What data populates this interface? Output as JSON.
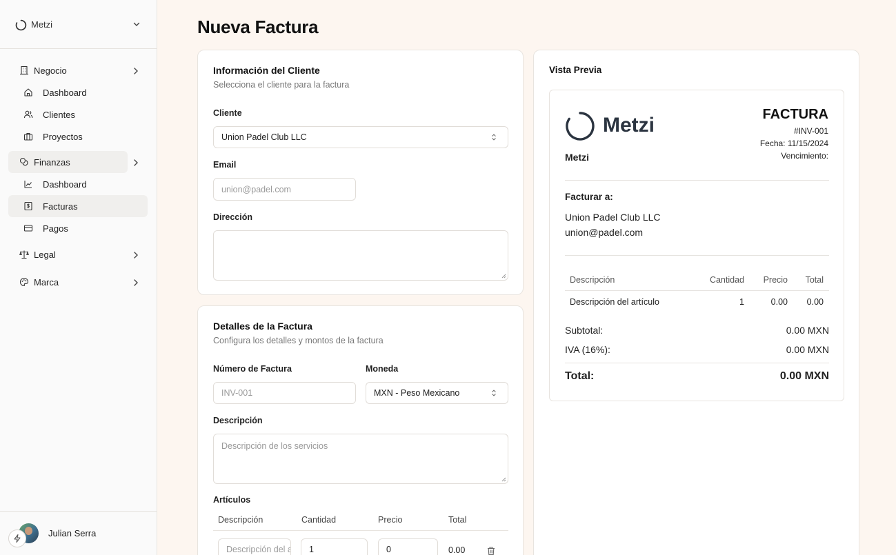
{
  "sidebar": {
    "brand": "Metzi",
    "groups": [
      {
        "label": "Negocio",
        "icon": "building-icon"
      },
      {
        "label": "Finanzas",
        "icon": "coins-icon"
      },
      {
        "label": "Legal",
        "icon": "scale-icon"
      },
      {
        "label": "Marca",
        "icon": "palette-icon"
      }
    ],
    "negocio_items": [
      {
        "label": "Dashboard",
        "icon": "home-icon"
      },
      {
        "label": "Clientes",
        "icon": "users-icon"
      },
      {
        "label": "Proyectos",
        "icon": "briefcase-icon"
      }
    ],
    "finanzas_items": [
      {
        "label": "Dashboard",
        "icon": "chart-icon"
      },
      {
        "label": "Facturas",
        "icon": "receipt-icon"
      },
      {
        "label": "Pagos",
        "icon": "credit-card-icon"
      }
    ],
    "user": {
      "name": "Julian Serra"
    }
  },
  "page": {
    "title": "Nueva Factura"
  },
  "client_card": {
    "title": "Información del Cliente",
    "subtitle": "Selecciona el cliente para la factura",
    "cliente_label": "Cliente",
    "cliente_value": "Union Padel Club LLC",
    "email_label": "Email",
    "email_placeholder": "union@padel.com",
    "direccion_label": "Dirección",
    "direccion_placeholder": ""
  },
  "details_card": {
    "title": "Detalles de la Factura",
    "subtitle": "Configura los detalles y montos de la factura",
    "numero_label": "Número de Factura",
    "numero_placeholder": "INV-001",
    "moneda_label": "Moneda",
    "moneda_value": "MXN - Peso Mexicano",
    "descripcion_label": "Descripción",
    "descripcion_placeholder": "Descripción de los servicios",
    "articulos_label": "Artículos",
    "columns": [
      "Descripción",
      "Cantidad",
      "Precio",
      "Total"
    ],
    "row": {
      "descripcion_placeholder": "Descripción del artículo",
      "cantidad": "1",
      "precio": "0",
      "total": "0.00"
    }
  },
  "preview": {
    "title": "Vista Previa",
    "logo_text": "Metzi",
    "company": "Metzi",
    "doc_title": "FACTURA",
    "number": "#INV-001",
    "fecha": "Fecha: 11/15/2024",
    "vencimiento": "Vencimiento:",
    "bill_to_label": "Facturar a:",
    "bill_to_name": "Union Padel Club LLC",
    "bill_to_email": "union@padel.com",
    "columns": [
      "Descripción",
      "Cantidad",
      "Precio",
      "Total"
    ],
    "row": {
      "descripcion": "Descripción del artículo",
      "cantidad": "1",
      "precio": "0.00",
      "total": "0.00"
    },
    "subtotal_label": "Subtotal:",
    "subtotal_value": "0.00 MXN",
    "iva_label": "IVA (16%):",
    "iva_value": "0.00 MXN",
    "total_label": "Total:",
    "total_value": "0.00 MXN"
  },
  "colors": {
    "background": "#fdf6f0",
    "sidebar": "#fafafa",
    "logo": "#2b3440"
  }
}
